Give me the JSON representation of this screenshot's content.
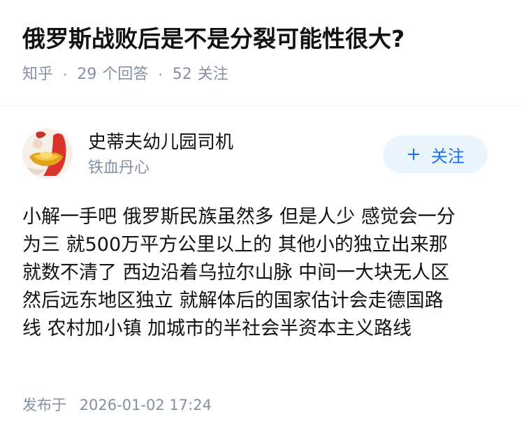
{
  "question": {
    "title": "俄罗斯战败后是不是分裂可能性很大?",
    "meta": {
      "source": "知乎",
      "answers_count": "29",
      "answers_label": "个回答",
      "followers_count": "52",
      "followers_label": "关注",
      "separator": "·"
    }
  },
  "author": {
    "name": "史蒂夫幼儿园司机",
    "headline": "铁血丹心",
    "avatar_icon": "avatar-gold-ingot",
    "follow_label": "关注",
    "follow_icon": "+"
  },
  "answer": {
    "lines": [
      "小解一手吧 俄罗斯民族虽然多 但是人少 感觉会一分",
      "为三 就500万平方公里以上的 其他小的独立出来那",
      "就数不清了 西边沿着乌拉尔山脉 中间一大块无人区",
      "然后远东地区独立 就解体后的国家估计会走德国路",
      "线 农村加小镇 加城市的半社会半资本主义路线"
    ]
  },
  "footer": {
    "published_label": "发布于",
    "published_time": "2026-01-02 17:24"
  },
  "colors": {
    "text": "#121212",
    "meta": "#8590a6",
    "accent": "#1772f6",
    "follow_bg": "#ebf5fd",
    "divider": "#f0f2f7"
  }
}
